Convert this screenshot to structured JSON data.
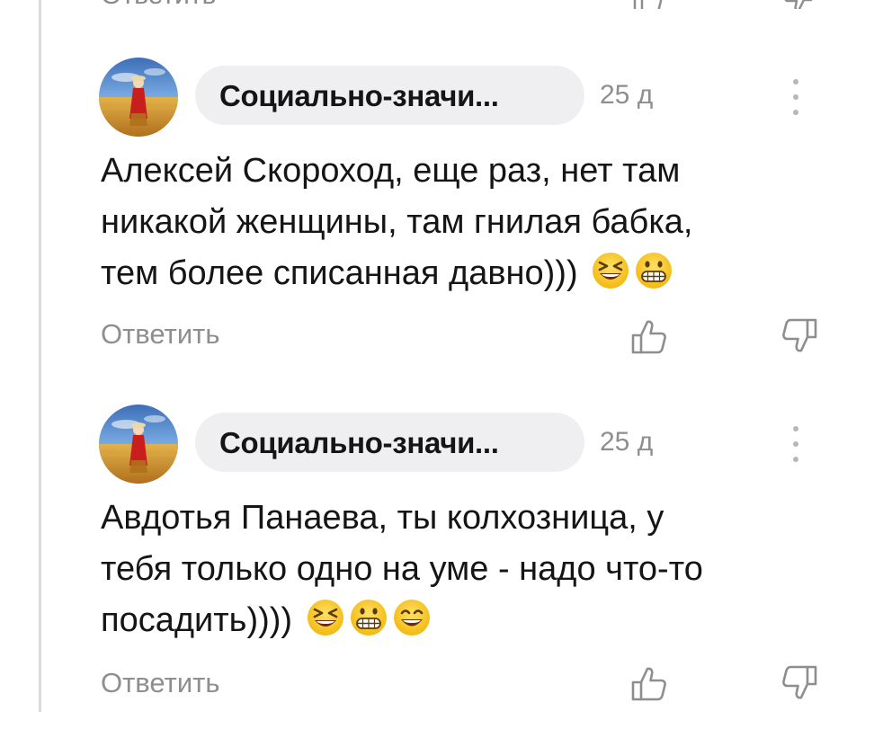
{
  "top_partial": {
    "reply_label": "Ответить"
  },
  "comments": [
    {
      "author": "Социально-значи...",
      "time": "25 д",
      "lines": [
        "Алексей Скороход, еще раз, нет там",
        "никакой женщины, там гнилая бабка,",
        "тем более списанная давно)))"
      ],
      "emojis": [
        "grinning-squinting-face",
        "grimacing-face"
      ],
      "reply_label": "Ответить"
    },
    {
      "author": "Социально-значи...",
      "time": "25 д",
      "lines": [
        "Авдотья Панаева, ты колхозница, у",
        "тебя только одно на уме - надо что-то",
        "посадить))))"
      ],
      "emojis": [
        "grinning-squinting-face",
        "grimacing-face",
        "smiling-face"
      ],
      "reply_label": "Ответить"
    }
  ],
  "colors": {
    "pill_bg": "#efeff2",
    "secondary_text": "#8e8e8e",
    "emoji_yellow": "#f5c518"
  }
}
